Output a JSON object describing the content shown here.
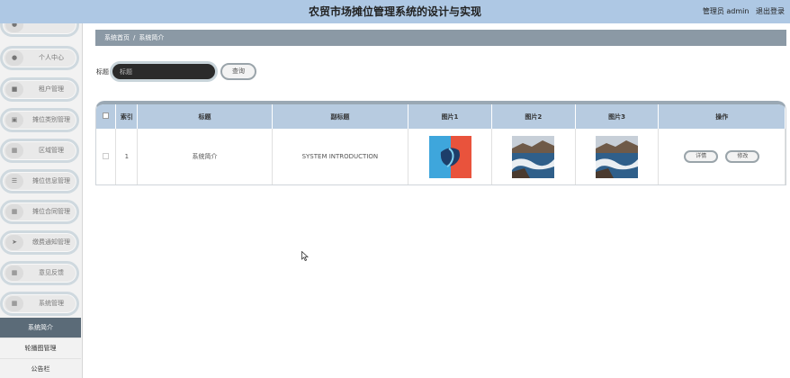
{
  "header": {
    "title": "农贸市场摊位管理系统的设计与实现",
    "user_label": "管理员 admin",
    "logout_label": "退出登录"
  },
  "sidebar": {
    "items": [
      {
        "label": "",
        "icon": "person-icon"
      },
      {
        "label": "个人中心",
        "icon": "person-icon"
      },
      {
        "label": "租户管理",
        "icon": "people-icon"
      },
      {
        "label": "摊位类别管理",
        "icon": "box-icon"
      },
      {
        "label": "区域管理",
        "icon": "grid-icon"
      },
      {
        "label": "摊位信息管理",
        "icon": "list-icon"
      },
      {
        "label": "摊位合同管理",
        "icon": "grid-icon"
      },
      {
        "label": "缴费通知管理",
        "icon": "send-icon"
      },
      {
        "label": "意见反馈",
        "icon": "grid-icon"
      },
      {
        "label": "系统管理",
        "icon": "grid-icon"
      }
    ],
    "sub_items": [
      {
        "label": "系统简介",
        "active": true
      },
      {
        "label": "轮播图管理",
        "active": false
      },
      {
        "label": "公告栏",
        "active": false
      }
    ]
  },
  "breadcrumb": {
    "home": "系统首页",
    "separator": "/",
    "current": "系统简介"
  },
  "search": {
    "label": "标题",
    "placeholder": "标题",
    "button_label": "查询"
  },
  "table": {
    "columns": [
      "",
      "索引",
      "标题",
      "副标题",
      "图片1",
      "图片2",
      "图片3",
      "操作"
    ],
    "rows": [
      {
        "index": "1",
        "title": "系统简介",
        "subtitle": "SYSTEM INTRODUCTION",
        "images": [
          "abstract-red-blue-image",
          "coast-landscape-image",
          "coast-landscape-image"
        ],
        "actions": [
          "详情",
          "修改"
        ]
      }
    ]
  },
  "colors": {
    "header_bg": "#aec8e4",
    "breadcrumb_bg": "#8b99a5",
    "table_header_bg": "#b7cbe0",
    "active_menu_bg": "#5b6b78"
  }
}
